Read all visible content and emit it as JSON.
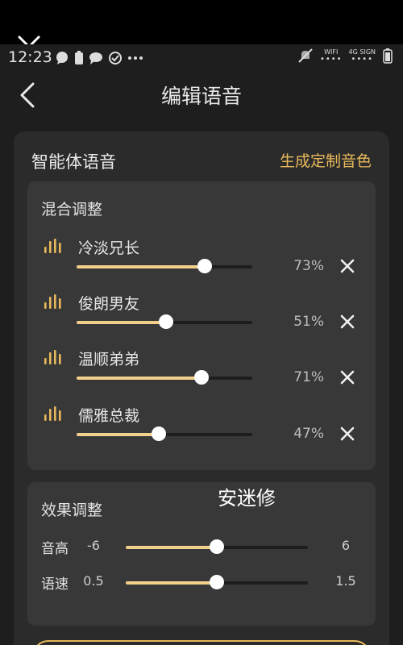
{
  "status_bar": {
    "time": "12:23",
    "icons": [
      "message-bubble-icon",
      "battery-icon",
      "chat-icon",
      "check-circle-icon",
      "more-dots-icon"
    ],
    "wifi_label": "WIFI",
    "signal_label": "4G SIGN"
  },
  "header": {
    "title": "编辑语音"
  },
  "card": {
    "title": "智能体语音",
    "action_label": "生成定制音色"
  },
  "mix_panel": {
    "title": "混合调整",
    "voices": [
      {
        "name": "冷淡兄长",
        "percent_label": "73%",
        "value": 0.73
      },
      {
        "name": "俊朗男友",
        "percent_label": "51%",
        "value": 0.51
      },
      {
        "name": "温顺弟弟",
        "percent_label": "71%",
        "value": 0.71
      },
      {
        "name": "儒雅总裁",
        "percent_label": "47%",
        "value": 0.47
      }
    ]
  },
  "effects_panel": {
    "title": "效果调整",
    "pitch": {
      "label": "音高",
      "min_label": "-6",
      "max_label": "6",
      "value": 0
    },
    "speed": {
      "label": "语速",
      "min_label": "0.5",
      "max_label": "1.5",
      "value": 1.0
    }
  },
  "watermark": "安迷修",
  "colors": {
    "accent": "#e8b95a",
    "slider_fill": "#f2cf8b",
    "background": "#1e1e1e",
    "card": "#2b2b2b",
    "panel": "#383838"
  }
}
